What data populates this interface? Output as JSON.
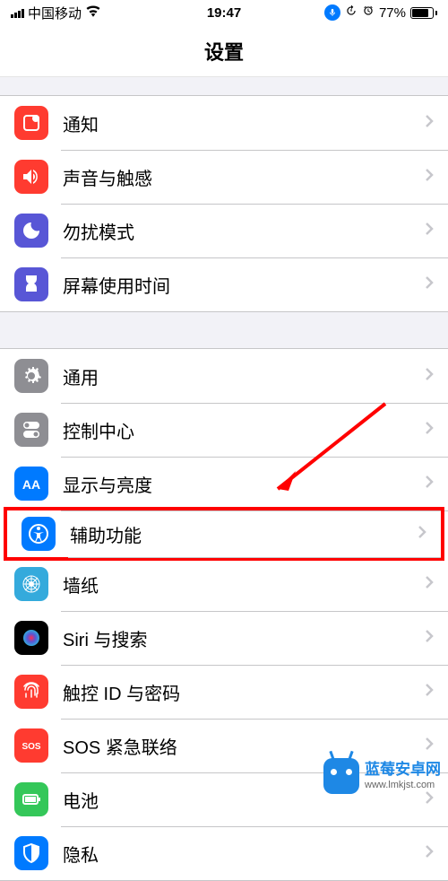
{
  "status": {
    "carrier": "中国移动",
    "time": "19:47",
    "battery_pct": "77%"
  },
  "header": {
    "title": "设置"
  },
  "group1": [
    {
      "icon": "notifications",
      "label": "通知",
      "color": "bg-red"
    },
    {
      "icon": "sound",
      "label": "声音与触感",
      "color": "bg-red"
    },
    {
      "icon": "dnd",
      "label": "勿扰模式",
      "color": "bg-purple"
    },
    {
      "icon": "screentime",
      "label": "屏幕使用时间",
      "color": "bg-purple"
    }
  ],
  "group2": [
    {
      "icon": "general",
      "label": "通用",
      "color": "bg-gray"
    },
    {
      "icon": "control",
      "label": "控制中心",
      "color": "bg-gray"
    },
    {
      "icon": "display",
      "label": "显示与亮度",
      "color": "bg-blue"
    },
    {
      "icon": "accessibility",
      "label": "辅助功能",
      "color": "bg-blue",
      "highlight": true
    },
    {
      "icon": "wallpaper",
      "label": "墙纸",
      "color": "bg-cyan"
    },
    {
      "icon": "siri",
      "label": "Siri 与搜索",
      "color": "bg-black"
    },
    {
      "icon": "touchid",
      "label": "触控 ID 与密码",
      "color": "bg-red"
    },
    {
      "icon": "sos",
      "label": "SOS 紧急联络",
      "color": "bg-red"
    },
    {
      "icon": "battery",
      "label": "电池",
      "color": "bg-green"
    },
    {
      "icon": "privacy",
      "label": "隐私",
      "color": "bg-blue"
    }
  ],
  "watermark": {
    "name": "蓝莓安卓网",
    "url": "www.lmkjst.com"
  }
}
